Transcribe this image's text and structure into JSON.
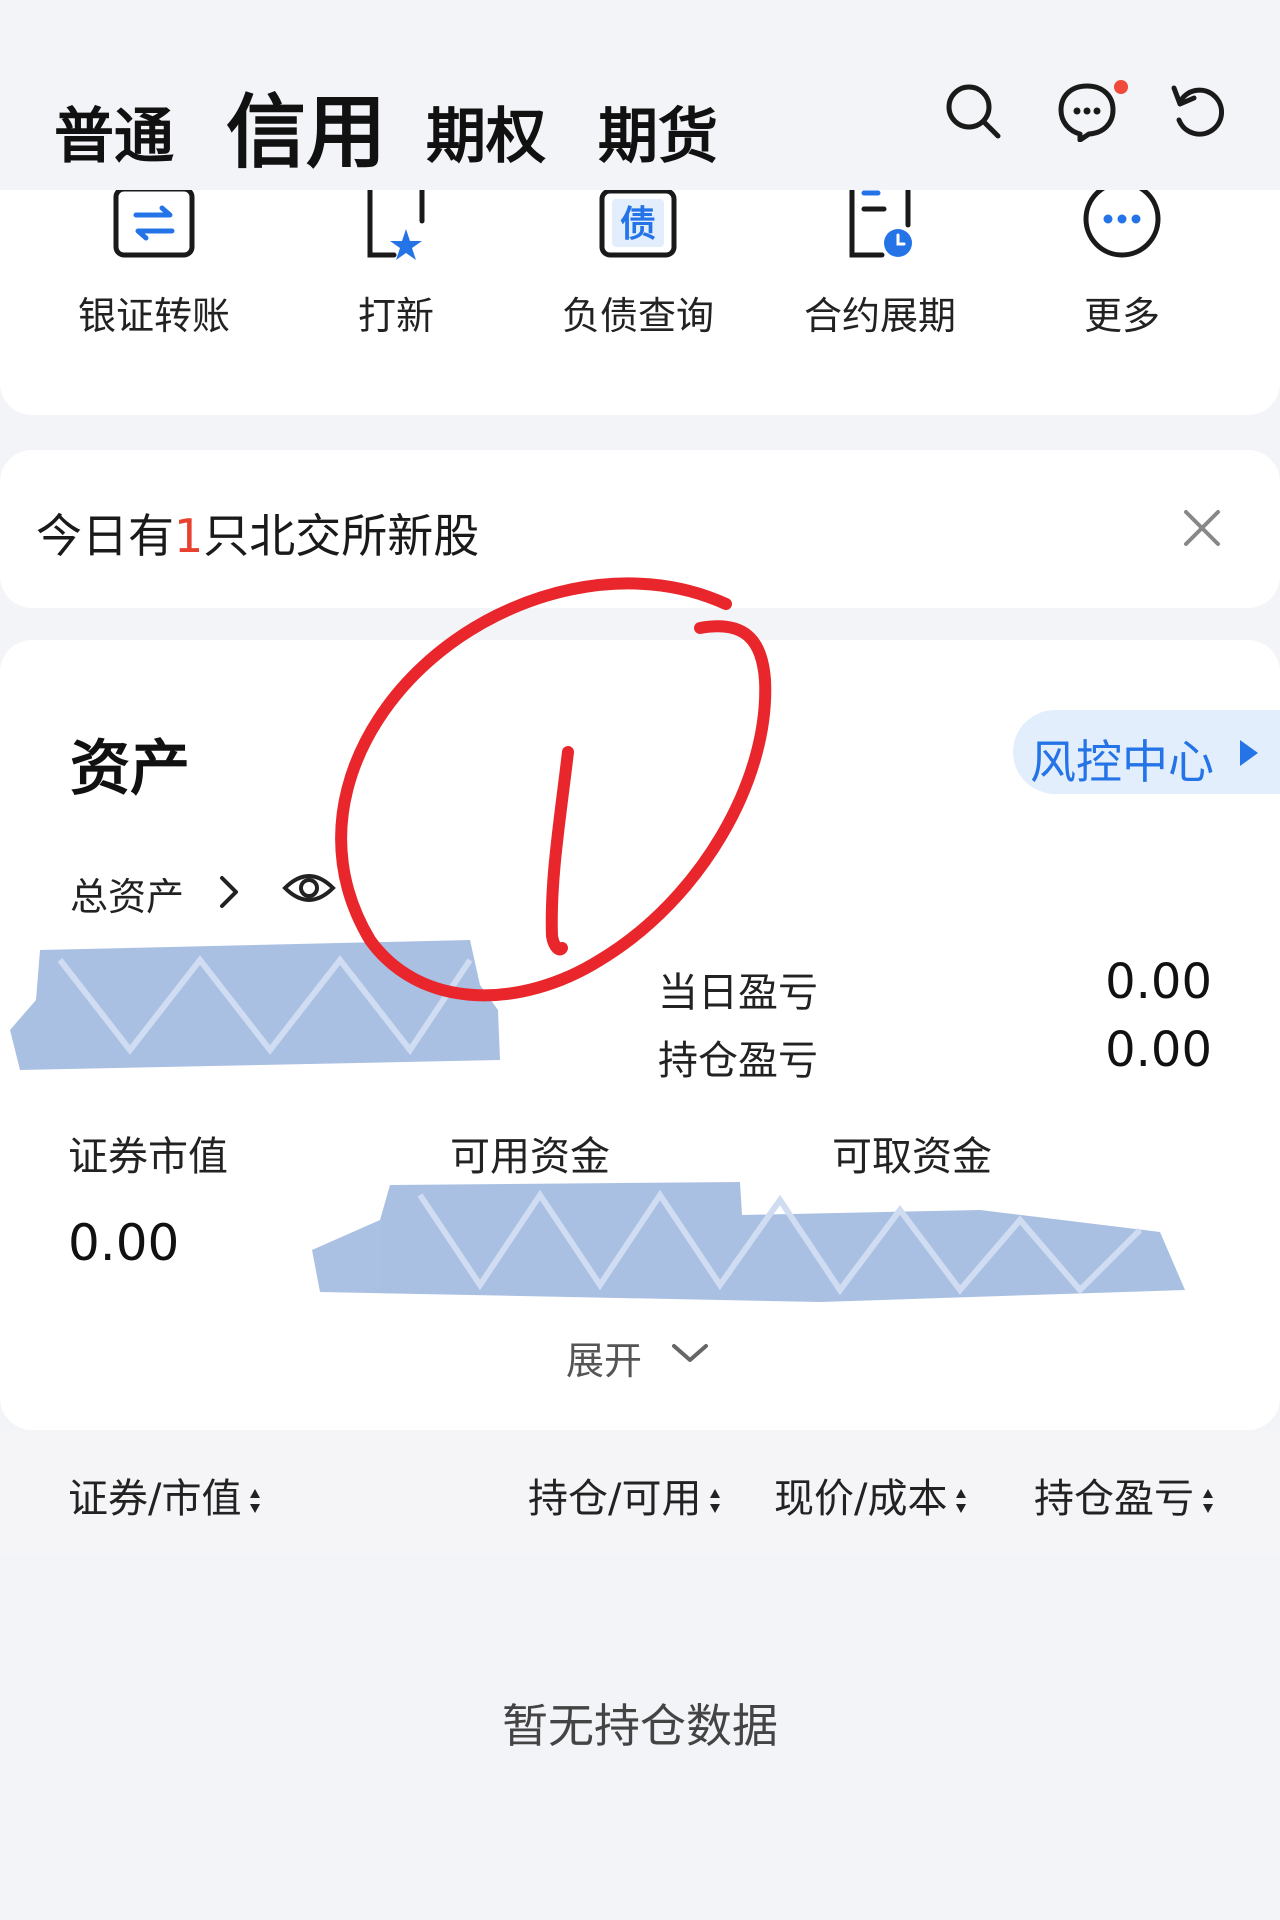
{
  "header": {
    "tabs": [
      {
        "label": "普通",
        "active": false
      },
      {
        "label": "信用",
        "active": true
      },
      {
        "label": "期权",
        "active": false
      },
      {
        "label": "期货",
        "active": false
      }
    ],
    "icons": [
      "search-icon",
      "message-icon",
      "refresh-icon"
    ],
    "has_unread_dot": true
  },
  "quick_actions": [
    {
      "label": "银证转账",
      "icon": "transfer-icon"
    },
    {
      "label": "打新",
      "icon": "new-stock-icon"
    },
    {
      "label": "负债查询",
      "icon": "debt-icon"
    },
    {
      "label": "合约展期",
      "icon": "contract-extend-icon"
    },
    {
      "label": "更多",
      "icon": "more-icon"
    }
  ],
  "notice": {
    "prefix": "今日有",
    "count": "1",
    "suffix": "只北交所新股"
  },
  "assets": {
    "title": "资产",
    "risk_center_label": "风控中心",
    "total_assets_label": "总资产",
    "daily_pnl_label": "当日盈亏",
    "daily_pnl_value": "0.00",
    "position_pnl_label": "持仓盈亏",
    "position_pnl_value": "0.00",
    "securities_value_label": "证券市值",
    "securities_value": "0.00",
    "available_funds_label": "可用资金",
    "withdrawable_funds_label": "可取资金",
    "expand_label": "展开"
  },
  "holdings_table": {
    "columns": [
      "证券/市值",
      "持仓/可用",
      "现价/成本",
      "持仓盈亏"
    ],
    "empty_text": "暂无持仓数据"
  },
  "annotation": {
    "handwritten_text": "1"
  },
  "colors": {
    "accent_blue": "#2474e8",
    "alert_red": "#e8412f",
    "background": "#f3f4f8"
  }
}
